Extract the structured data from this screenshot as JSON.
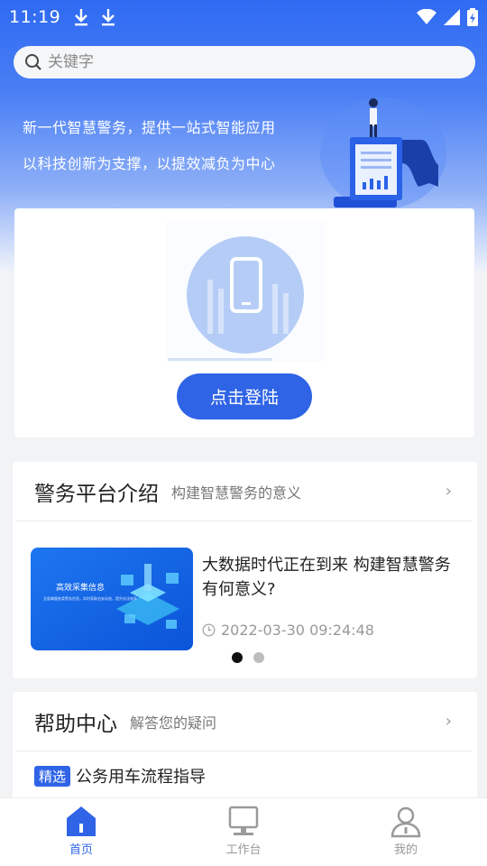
{
  "status_bar": {
    "time": "11:19"
  },
  "search": {
    "placeholder": "关键字"
  },
  "hero": {
    "slogan_line1": "新一代智慧警务，提供一站式智能应用",
    "slogan_line2": "以科技创新为支撑，以提效减负为中心"
  },
  "login": {
    "button_label": "点击登陆"
  },
  "intro_section": {
    "title": "警务平台介绍",
    "subtitle": "构建智慧警务的意义",
    "news": {
      "thumb_title": "高效采集信息",
      "thumb_caption": "全面掌握各类警务信息，实时获取治安动态，提升执法效率",
      "title": "大数据时代正在到来 构建智慧警务有何意义?",
      "date": "2022-03-30 09:24:48"
    },
    "carousel": {
      "total": 2,
      "active": 1
    }
  },
  "help_section": {
    "title": "帮助中心",
    "subtitle": "解答您的疑问",
    "items": [
      {
        "tag": "精选",
        "text": "公务用车流程指导"
      }
    ]
  },
  "tabbar": {
    "tabs": [
      {
        "label": "首页",
        "icon": "home-icon",
        "active": true
      },
      {
        "label": "工作台",
        "icon": "desktop-icon",
        "active": false
      },
      {
        "label": "我的",
        "icon": "person-icon",
        "active": false
      }
    ]
  },
  "colors": {
    "primary": "#2f64e6",
    "hero_top": "#2f6af2"
  }
}
